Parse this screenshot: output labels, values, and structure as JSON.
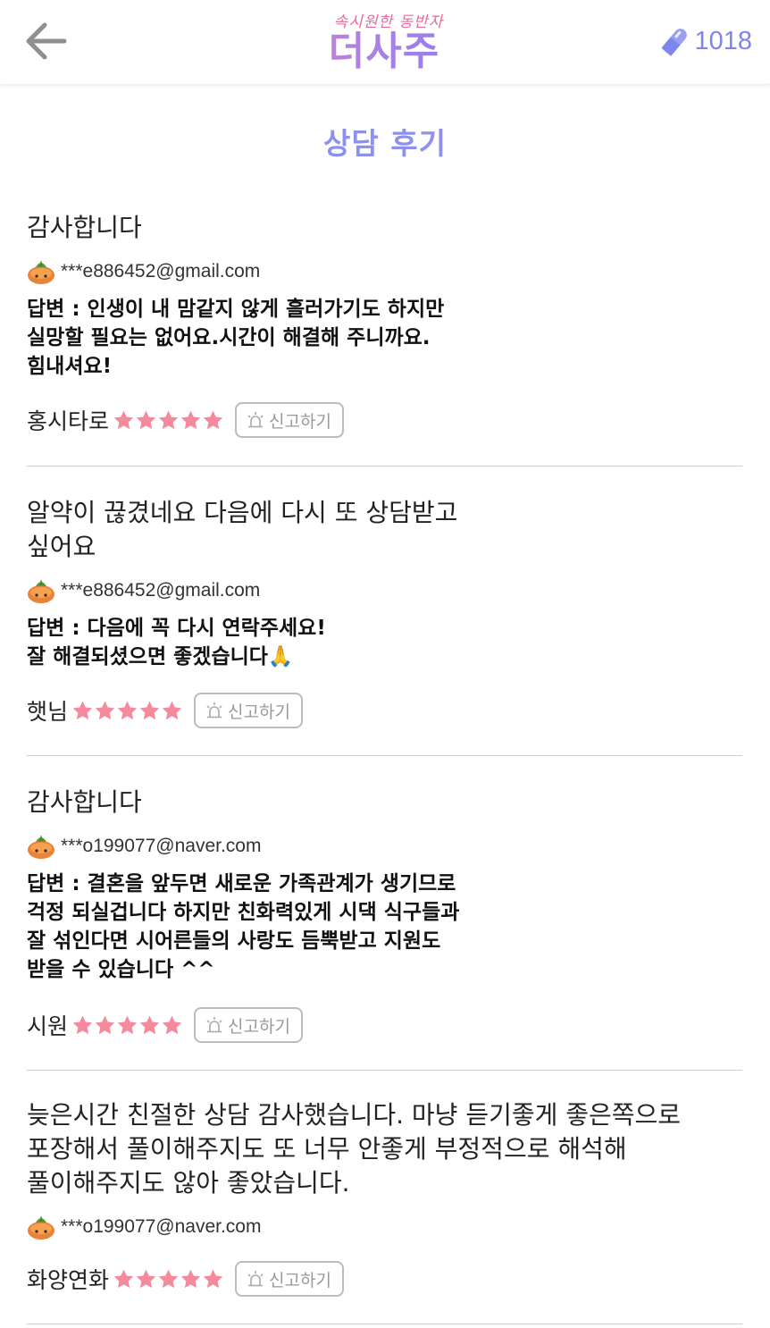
{
  "header": {
    "logo_tagline": "속시원한 동반자",
    "logo_name": "더사주",
    "coin_count": "1018"
  },
  "page": {
    "title": "상담 후기"
  },
  "report_label": "신고하기",
  "colors": {
    "accent": "#8e90ee",
    "star": "#f58a9d",
    "logo_pink": "#e86a9a",
    "coin": "#7d85ee"
  },
  "reviews": [
    {
      "title": "감사합니다",
      "email": "***e886452@gmail.com",
      "answer": "답변 : 인생이 내 맘같지 않게 흘러가기도 하지만\n실망할 필요는 없어요.시간이 해결해 주니까요.\n힘내셔요!",
      "counselor": "홍시타로",
      "rating": 5
    },
    {
      "title": "알약이 끊겼네요 다음에 다시 또 상담받고\n싶어요",
      "email": "***e886452@gmail.com",
      "answer": "답변 : 다음에 꼭 다시 연락주세요!\n잘 해결되셨으면 좋겠습니다🙏",
      "counselor": "햇님",
      "rating": 5
    },
    {
      "title": "감사합니다",
      "email": "***o199077@naver.com",
      "answer": "답변 : 결혼을 앞두면 새로운 가족관계가 생기므로\n걱정 되실겁니다 하지만 친화력있게 시댁 식구들과\n잘 섞인다면 시어른들의 사랑도 듬뿍받고 지원도\n받을 수 있습니다 ^^",
      "counselor": "시원",
      "rating": 5
    },
    {
      "title": "늦은시간 친절한 상담 감사했습니다. 마냥 듣기좋게 좋은쪽으로\n포장해서 풀이해주지도 또 너무 안좋게 부정적으로 해석해\n풀이해주지도 않아 좋았습니다.",
      "email": "***o199077@naver.com",
      "answer": "",
      "counselor": "화양연화",
      "rating": 5
    }
  ]
}
